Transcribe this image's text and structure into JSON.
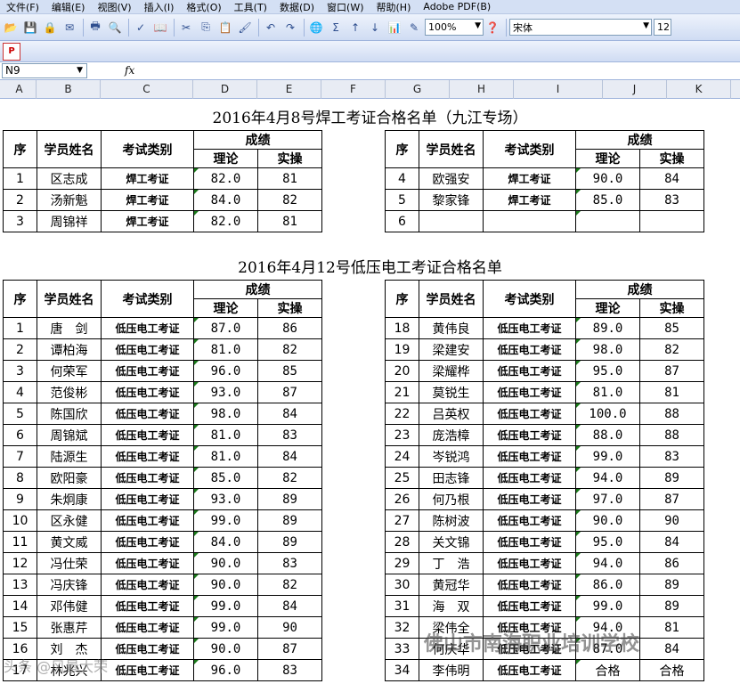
{
  "menu": [
    "文件(F)",
    "编辑(E)",
    "视图(V)",
    "插入(I)",
    "格式(O)",
    "工具(T)",
    "数据(D)",
    "窗口(W)",
    "帮助(H)",
    "Adobe PDF(B)"
  ],
  "toolbar": {
    "zoom": "100%",
    "font": "宋体",
    "font_size": "12",
    "sigma": "Σ"
  },
  "formula": {
    "cell_ref": "N9",
    "fx": "fx"
  },
  "columns": [
    "A",
    "B",
    "C",
    "D",
    "E",
    "F",
    "G",
    "H",
    "I",
    "J",
    "K"
  ],
  "section1": {
    "title": "2016年4月8号焊工考证合格名单（九江专场）",
    "headers": {
      "seq": "序",
      "name": "学员姓名",
      "cat": "考试类别",
      "score": "成绩",
      "theory": "理论",
      "practice": "实操"
    },
    "left": [
      [
        "1",
        "区志成",
        "焊工考证",
        "82.0",
        "81"
      ],
      [
        "2",
        "汤新魁",
        "焊工考证",
        "84.0",
        "82"
      ],
      [
        "3",
        "周锦祥",
        "焊工考证",
        "82.0",
        "81"
      ]
    ],
    "right": [
      [
        "4",
        "欧强安",
        "焊工考证",
        "90.0",
        "84"
      ],
      [
        "5",
        "黎家锋",
        "焊工考证",
        "85.0",
        "83"
      ],
      [
        "6",
        "",
        "",
        "",
        ""
      ]
    ]
  },
  "section2": {
    "title": "2016年4月12号低压电工考证合格名单",
    "headers": {
      "seq": "序",
      "name": "学员姓名",
      "cat": "考试类别",
      "score": "成绩",
      "theory": "理论",
      "practice": "实操"
    },
    "left": [
      [
        "1",
        "唐　剑",
        "低压电工考证",
        "87.0",
        "86"
      ],
      [
        "2",
        "谭柏海",
        "低压电工考证",
        "81.0",
        "82"
      ],
      [
        "3",
        "何荣军",
        "低压电工考证",
        "96.0",
        "85"
      ],
      [
        "4",
        "范俊彬",
        "低压电工考证",
        "93.0",
        "87"
      ],
      [
        "5",
        "陈国欣",
        "低压电工考证",
        "98.0",
        "84"
      ],
      [
        "6",
        "周锦斌",
        "低压电工考证",
        "81.0",
        "83"
      ],
      [
        "7",
        "陆源生",
        "低压电工考证",
        "81.0",
        "84"
      ],
      [
        "8",
        "欧阳豪",
        "低压电工考证",
        "85.0",
        "82"
      ],
      [
        "9",
        "朱炯康",
        "低压电工考证",
        "93.0",
        "89"
      ],
      [
        "10",
        "区永健",
        "低压电工考证",
        "99.0",
        "89"
      ],
      [
        "11",
        "黄文威",
        "低压电工考证",
        "84.0",
        "89"
      ],
      [
        "12",
        "冯仕荣",
        "低压电工考证",
        "90.0",
        "83"
      ],
      [
        "13",
        "冯庆锋",
        "低压电工考证",
        "90.0",
        "82"
      ],
      [
        "14",
        "邓伟健",
        "低压电工考证",
        "99.0",
        "84"
      ],
      [
        "15",
        "张惠芹",
        "低压电工考证",
        "99.0",
        "90"
      ],
      [
        "16",
        "刘　杰",
        "低压电工考证",
        "90.0",
        "87"
      ],
      [
        "17",
        "林兆兴",
        "低压电工考证",
        "96.0",
        "83"
      ]
    ],
    "right": [
      [
        "18",
        "黄伟良",
        "低压电工考证",
        "89.0",
        "85"
      ],
      [
        "19",
        "梁建安",
        "低压电工考证",
        "98.0",
        "82"
      ],
      [
        "20",
        "梁耀桦",
        "低压电工考证",
        "95.0",
        "87"
      ],
      [
        "21",
        "莫锐生",
        "低压电工考证",
        "81.0",
        "81"
      ],
      [
        "22",
        "吕英权",
        "低压电工考证",
        "100.0",
        "88"
      ],
      [
        "23",
        "庞浩樟",
        "低压电工考证",
        "88.0",
        "88"
      ],
      [
        "24",
        "岑锐鸿",
        "低压电工考证",
        "99.0",
        "83"
      ],
      [
        "25",
        "田志锋",
        "低压电工考证",
        "94.0",
        "89"
      ],
      [
        "26",
        "何乃根",
        "低压电工考证",
        "97.0",
        "87"
      ],
      [
        "27",
        "陈树波",
        "低压电工考证",
        "90.0",
        "90"
      ],
      [
        "28",
        "关文锦",
        "低压电工考证",
        "95.0",
        "84"
      ],
      [
        "29",
        "丁　浩",
        "低压电工考证",
        "94.0",
        "86"
      ],
      [
        "30",
        "黄冠华",
        "低压电工考证",
        "86.0",
        "89"
      ],
      [
        "31",
        "海　双",
        "低压电工考证",
        "99.0",
        "89"
      ],
      [
        "32",
        "梁伟全",
        "低压电工考证",
        "94.0",
        "81"
      ],
      [
        "33",
        "何庆华",
        "低压电工考证",
        "87.0",
        "84"
      ],
      [
        "34",
        "李伟明",
        "低压电工考证",
        "合格",
        "合格"
      ]
    ]
  },
  "watermark": "佛山市南海职业培训学校",
  "watermark2": "头条 @风景大荣"
}
